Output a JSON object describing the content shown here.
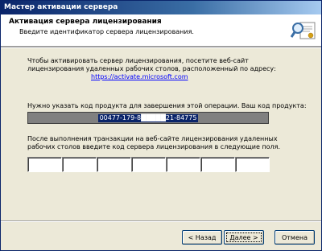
{
  "window": {
    "title": "Мастер активации сервера"
  },
  "header": {
    "title": "Активация сервера лицензирования",
    "subtitle": "Введите идентификатор сервера лицензирования."
  },
  "body": {
    "intro_line1": "Чтобы активировать сервер лицензирования, посетите веб-сайт",
    "intro_line2": "лицензирования удаленных рабочих столов, расположенный по адресу:",
    "url": "https://activate.microsoft.com",
    "code_prompt": "Нужно указать код продукта для завершения этой операции. Ваш код продукта:",
    "product_code": "00477-179-8█████21-84775",
    "after_line1": "После выполнения транзакции на веб-сайте лицензирования удаленных",
    "after_line2": "рабочих столов введите код сервера лицензирования в следующие поля.",
    "field_count": 7
  },
  "buttons": {
    "back": "< Назад",
    "next": "Далее >",
    "cancel": "Отмена"
  },
  "icons": {
    "header_icon": "certificate-search-icon"
  }
}
